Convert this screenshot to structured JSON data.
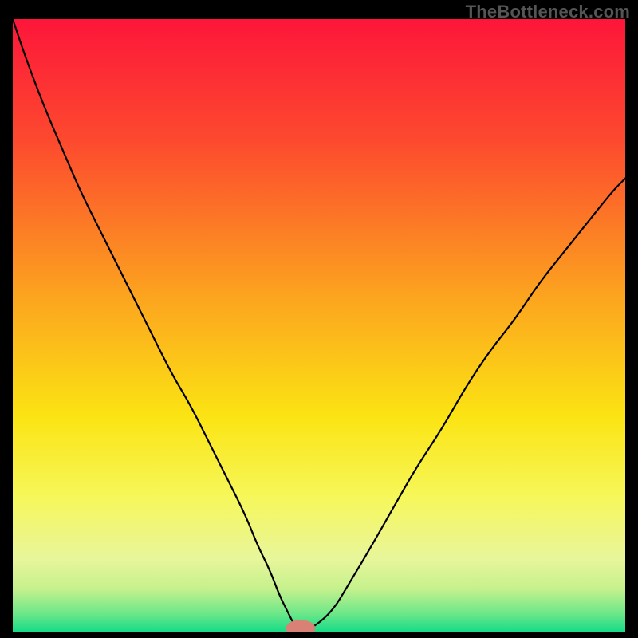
{
  "watermark": "TheBottleneck.com",
  "chart_data": {
    "type": "line",
    "title": "",
    "xlabel": "",
    "ylabel": "",
    "xlim": [
      0,
      100
    ],
    "ylim": [
      0,
      100
    ],
    "grid": false,
    "legend": false,
    "annotations": [],
    "background_gradient_stops": [
      {
        "offset": 0.0,
        "color": "#fd163a"
      },
      {
        "offset": 0.2,
        "color": "#fd4a2e"
      },
      {
        "offset": 0.45,
        "color": "#fca31f"
      },
      {
        "offset": 0.65,
        "color": "#fbe413"
      },
      {
        "offset": 0.78,
        "color": "#f6f75a"
      },
      {
        "offset": 0.88,
        "color": "#e8f69a"
      },
      {
        "offset": 0.93,
        "color": "#c6f18d"
      },
      {
        "offset": 0.97,
        "color": "#6ee789"
      },
      {
        "offset": 1.0,
        "color": "#17dc87"
      }
    ],
    "series": [
      {
        "name": "curve",
        "color": "#000000",
        "x": [
          0,
          2,
          5,
          8,
          11,
          14,
          17,
          20,
          23,
          26,
          29,
          32,
          35,
          38,
          40,
          42,
          43.5,
          45,
          46,
          47,
          48,
          52,
          55,
          58,
          62,
          66,
          70,
          74,
          78,
          82,
          86,
          90,
          94,
          98,
          100
        ],
        "values": [
          100,
          94,
          86,
          79,
          72,
          66,
          60,
          54,
          48,
          42,
          37,
          31,
          25,
          19,
          14,
          10,
          6,
          3,
          1,
          0,
          0,
          3,
          8,
          13,
          20,
          27,
          33,
          40,
          46,
          51,
          57,
          62,
          67,
          72,
          74
        ]
      }
    ],
    "marker": {
      "name": "min-marker",
      "x": 47,
      "y": 0,
      "rx": 2.4,
      "ry": 1.4,
      "color": "#da8176"
    }
  }
}
